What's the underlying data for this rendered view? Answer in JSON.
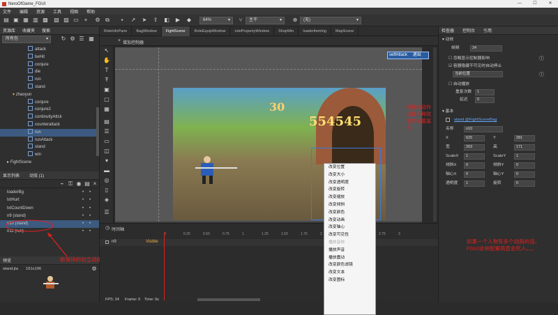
{
  "window": {
    "title": "NeroOfGame_FGUI",
    "minimize": "—",
    "maximize": "☐",
    "close": "✕"
  },
  "menu": [
    "文件",
    "编辑",
    "资源",
    "工具",
    "视图",
    "帮助"
  ],
  "toolbar": {
    "zoom": "64%",
    "platform": "主干",
    "branch": "(无)"
  },
  "left_panel": {
    "tabs": {
      "library": "资源库",
      "favorites": "收藏夹",
      "search": "搜索"
    },
    "package_filter": "所有包",
    "tree": [
      {
        "label": "attack",
        "kind": "leaf"
      },
      {
        "label": "beHit",
        "kind": "leaf"
      },
      {
        "label": "conjure",
        "kind": "leaf"
      },
      {
        "label": "die",
        "kind": "leaf"
      },
      {
        "label": "run",
        "kind": "leaf"
      },
      {
        "label": "stand",
        "kind": "leaf"
      },
      {
        "label": "zhaoyun",
        "kind": "folder"
      },
      {
        "label": "conjure",
        "kind": "leaf"
      },
      {
        "label": "conjure2",
        "kind": "leaf"
      },
      {
        "label": "continuityAttck",
        "kind": "leaf"
      },
      {
        "label": "counterattack",
        "kind": "leaf"
      },
      {
        "label": "run",
        "kind": "leaf",
        "selected": true
      },
      {
        "label": "runAttack",
        "kind": "leaf"
      },
      {
        "label": "stand",
        "kind": "leaf"
      },
      {
        "label": "win",
        "kind": "leaf"
      },
      {
        "label": "FightScene",
        "kind": "component"
      }
    ],
    "display_list_tabs": {
      "display": "显示列表",
      "animation": "动效 (1)"
    },
    "display_list": [
      {
        "label": "loaderBg"
      },
      {
        "label": "txtHurt"
      },
      {
        "label": "txtCountDown"
      },
      {
        "label": "n9 (stand)"
      },
      {
        "label": "n10 (stand)",
        "selected": true
      },
      {
        "label": "n11 (run)"
      }
    ],
    "preview": {
      "title": "预览",
      "file": "stand.jta",
      "size": "161x106"
    }
  },
  "tabs": [
    "RoleInfoPane",
    "BagWindow",
    "FightScene",
    "RoleEquipWindow",
    "rolePropertyWindow",
    "ShopWin",
    "loaderItemIng",
    "MapScene"
  ],
  "active_tab": "FightScene",
  "stage": {
    "add_controller": "增加控制器",
    "self_attack": "selfAttack",
    "exit": "退出",
    "score": "554545",
    "timer": "30"
  },
  "context_menu": [
    "改变位置",
    "改变大小",
    "改变透明度",
    "改变旋转",
    "改变缩放",
    "改变倾斜",
    "改变颜色",
    "改变动画",
    "改变轴心",
    "改变可见性",
    "播放音效",
    "播放声音",
    "播放震动",
    "改变颜色滤镜",
    "改变文本",
    "改变图标"
  ],
  "context_menu_disabled_index": 10,
  "timeline": {
    "title": "时间轴",
    "track": "n9",
    "track_prop": "Visible",
    "ticks": [
      "0",
      "0.25",
      "0.50",
      "0.75",
      "1",
      "1.25",
      "1.50",
      "1.75",
      "2",
      "2.25",
      "2.5",
      "2.75",
      "3"
    ],
    "fps": "FPS: 24",
    "frame": "Frame: 0",
    "time": "Time: 0s"
  },
  "right_panel": {
    "tabs": {
      "inspector": "检查器",
      "controller": "控制台",
      "reference": "引用"
    },
    "section_anim": "动效",
    "frame_rate_label": "帧频",
    "frame_rate": "24",
    "ignore_label": "忽略显示控制器影响",
    "autostop_label": "容器隐藏不可见时自动停止",
    "current_pos": "当前位置",
    "autoplay_label": "自动播放",
    "repeat_label": "重复次数",
    "repeat_value": "1",
    "delay_label": "延迟",
    "delay_value": "0",
    "section_basic": "基本",
    "source": "stand @FightSceneBag",
    "name_label": "名称",
    "name_value": "n10",
    "x_label": "X",
    "x_value": "625",
    "y_label": "Y",
    "y_value": "281",
    "w_label": "宽",
    "w_value": "203",
    "h_label": "高",
    "h_value": "171",
    "sx_label": "ScaleX",
    "sx_value": "1",
    "sy_label": "ScaleY",
    "sy_value": "1",
    "skx_label": "倾斜X",
    "skx_value": "0",
    "sky_label": "倾斜Y",
    "sky_value": "0",
    "px_label": "轴心X",
    "px_value": "0",
    "py_label": "轴心Y",
    "py_value": "0",
    "alpha_label": "透明度",
    "alpha_value": "1",
    "rot_label": "旋转",
    "rot_value": "0"
  },
  "annotations": {
    "left": "新保持的站立动画",
    "stage": "同样的动作设置十种改变的设置属性",
    "right": "如果一个人物有多个动画的话，FGUI这种配置简直会死人。。。"
  }
}
